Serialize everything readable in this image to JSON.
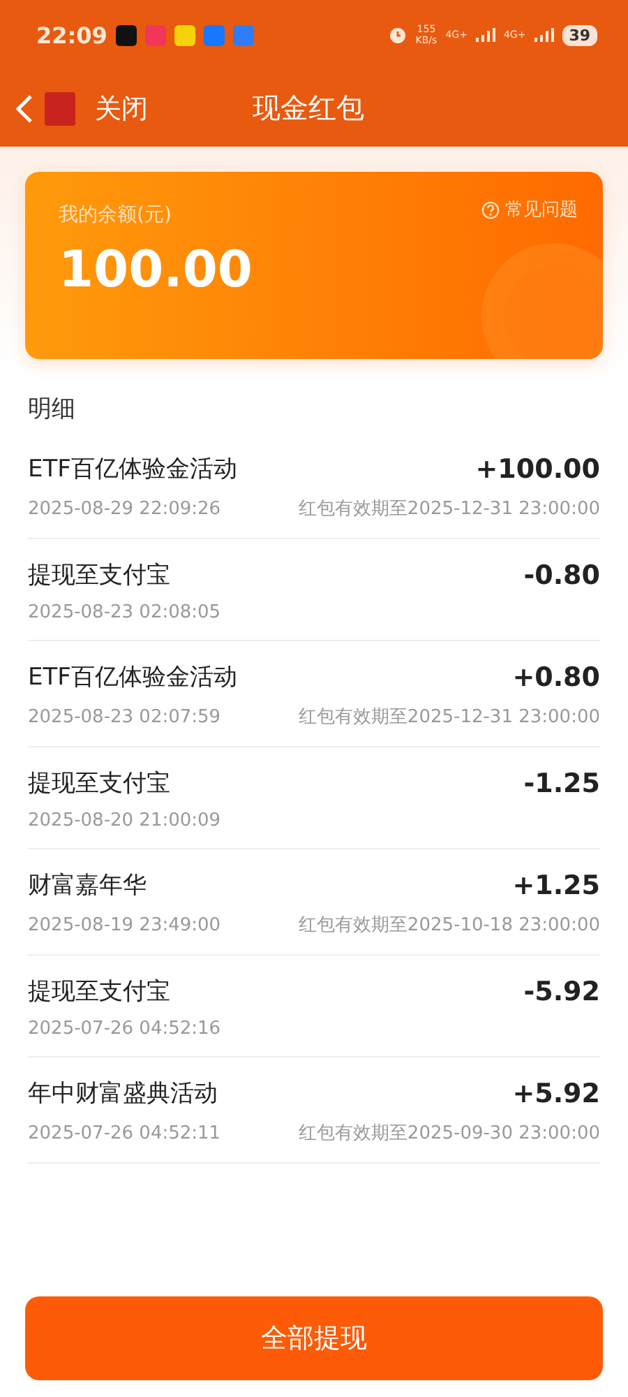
{
  "status_bar": {
    "time": "22:09",
    "network_speed": "155",
    "network_unit": "KB/s",
    "signal_1": "4G+",
    "signal_2": "4G+",
    "battery": "39"
  },
  "nav": {
    "close": "关闭",
    "title": "现金红包"
  },
  "balance_card": {
    "label": "我的余额(元)",
    "amount": "100.00",
    "help": "常见问题"
  },
  "details": {
    "heading": "明细",
    "rows": [
      {
        "title": "ETF百亿体验金活动",
        "time": "2025-08-29 22:09:26",
        "amount": "+100.00",
        "note": "红包有效期至2025-12-31 23:00:00"
      },
      {
        "title": "提现至支付宝",
        "time": "2025-08-23 02:08:05",
        "amount": "-0.80"
      },
      {
        "title": "ETF百亿体验金活动",
        "time": "2025-08-23 02:07:59",
        "amount": "+0.80",
        "note": "红包有效期至2025-12-31 23:00:00"
      },
      {
        "title": "提现至支付宝",
        "time": "2025-08-20 21:00:09",
        "amount": "-1.25"
      },
      {
        "title": "财富嘉年华",
        "time": "2025-08-19 23:49:00",
        "amount": "+1.25",
        "note": "红包有效期至2025-10-18 23:00:00"
      },
      {
        "title": "提现至支付宝",
        "time": "2025-07-26 04:52:16",
        "amount": "-5.92"
      },
      {
        "title": "年中财富盛典活动",
        "time": "2025-07-26 04:52:11",
        "amount": "+5.92",
        "note": "红包有效期至2025-09-30 23:00:00"
      }
    ]
  },
  "withdraw_button": "全部提现"
}
